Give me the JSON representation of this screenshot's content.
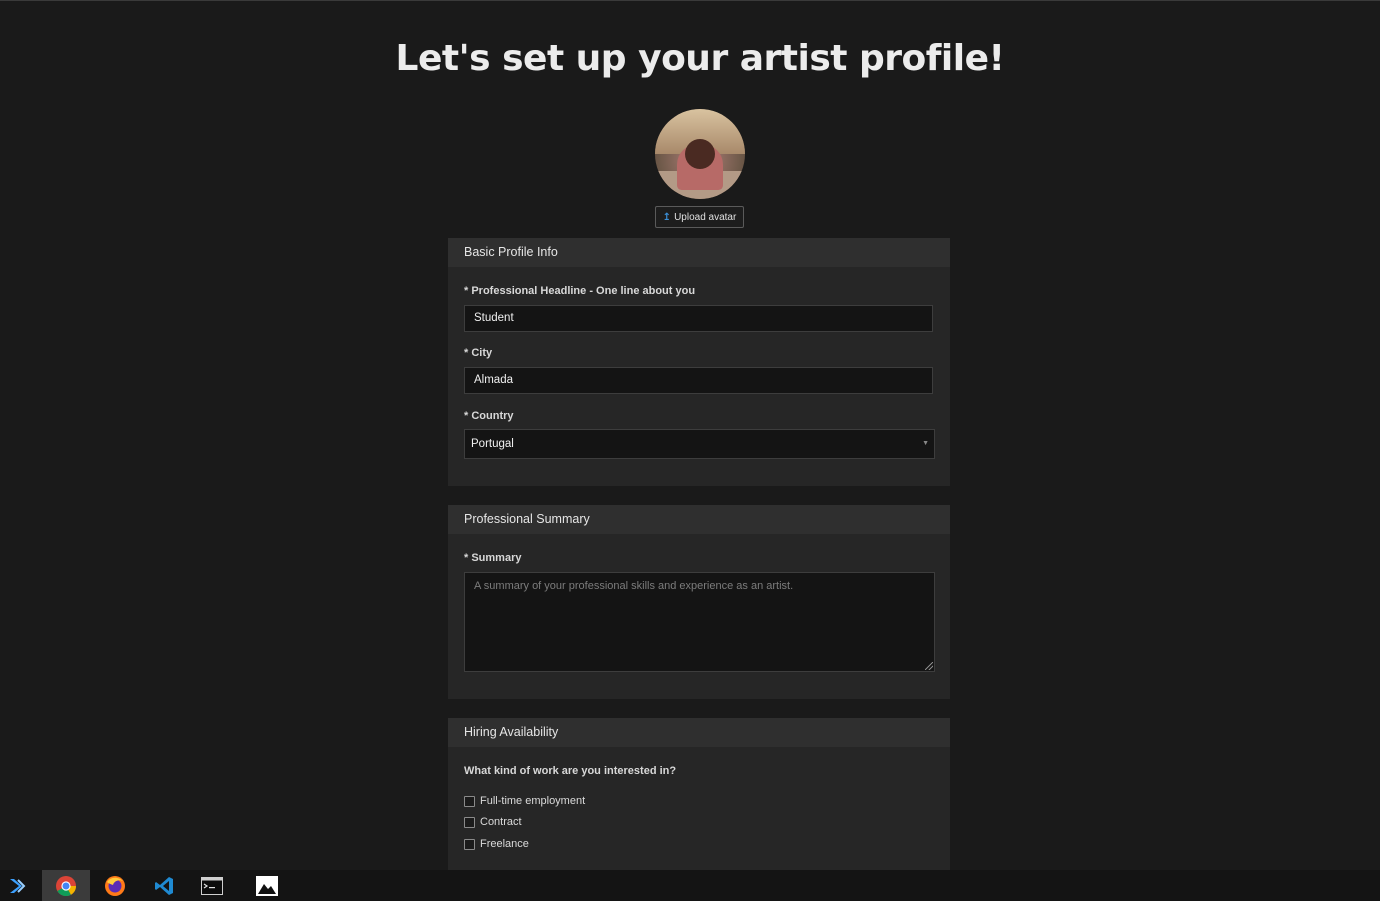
{
  "page": {
    "title": "Let's set up your artist profile!"
  },
  "avatar": {
    "upload_label": "Upload avatar"
  },
  "basic_info": {
    "header": "Basic Profile Info",
    "headline_label": "* Professional Headline - One line about you",
    "headline_value": "Student",
    "city_label": "* City",
    "city_value": "Almada",
    "country_label": "* Country",
    "country_value": "Portugal"
  },
  "summary": {
    "header": "Professional Summary",
    "label": "* Summary",
    "placeholder": "A summary of your professional skills and experience as an artist."
  },
  "hiring": {
    "header": "Hiring Availability",
    "question": "What kind of work are you interested in?",
    "options": [
      {
        "label": "Full-time employment",
        "checked": false
      },
      {
        "label": "Contract",
        "checked": false
      },
      {
        "label": "Freelance",
        "checked": false
      }
    ]
  },
  "taskbar": {
    "items": [
      {
        "icon": "visual-studio-icon"
      },
      {
        "icon": "chrome-icon",
        "active": true
      },
      {
        "icon": "firefox-icon"
      },
      {
        "icon": "vscode-icon"
      },
      {
        "icon": "terminal-icon"
      },
      {
        "icon": "image-viewer-icon"
      }
    ]
  },
  "colors": {
    "background": "#1a1a1a",
    "panel": "#262626",
    "panel_header": "#2f2f2f",
    "accent": "#3b8fd6"
  }
}
